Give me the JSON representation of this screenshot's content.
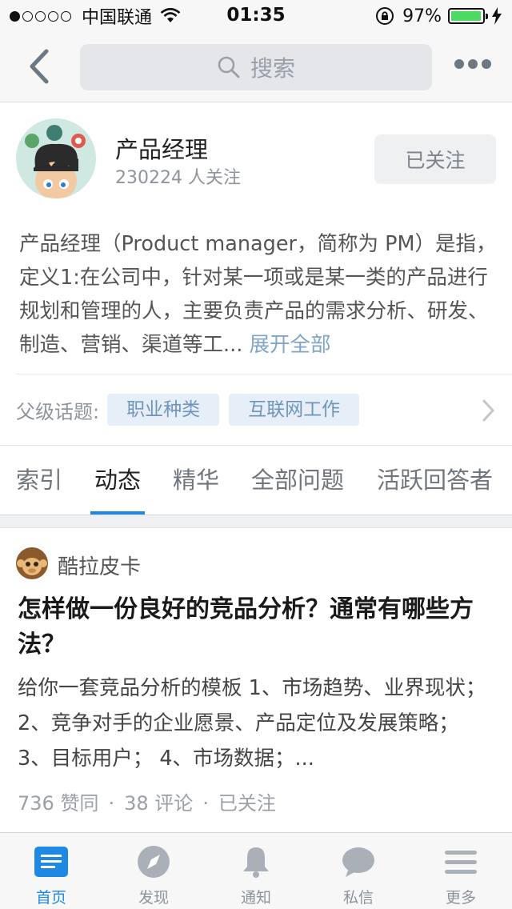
{
  "status_bar": {
    "carrier": "中国联通",
    "time": "01:35",
    "battery": "97%",
    "battery_level": 0.97
  },
  "nav": {
    "search_placeholder": "搜索"
  },
  "topic": {
    "title": "产品经理",
    "followers": "230224 人关注",
    "follow_label": "已关注",
    "description": "产品经理（Product manager，简称为 PM）是指，定义1:在公司中，针对某一项或是某一类的产品进行规划和管理的人，主要负责产品的需求分析、研发、制造、营销、渠道等工...",
    "expand_label": "展开全部",
    "parent_label": "父级话题:",
    "parent_tags": [
      "职业种类",
      "互联网工作"
    ]
  },
  "tabs": [
    "索引",
    "动态",
    "精华",
    "全部问题",
    "活跃回答者"
  ],
  "active_tab": "动态",
  "feed": [
    {
      "author": "酷拉皮卡",
      "title": "怎样做一份良好的竞品分析？通常有哪些方法？",
      "excerpt": "给你一套竞品分析的模板 1、市场趋势、业界现状； 2、竞争对手的企业愿景、产品定位及发展策略； 3、目标用户； 4、市场数据；...",
      "likes": "736 赞同",
      "comments": "38 评论",
      "status": "已关注"
    }
  ],
  "tab_bar": {
    "items": [
      {
        "label": "首页",
        "icon": "home-icon"
      },
      {
        "label": "发现",
        "icon": "compass-icon"
      },
      {
        "label": "通知",
        "icon": "bell-icon"
      },
      {
        "label": "私信",
        "icon": "chat-bubble-icon"
      },
      {
        "label": "更多",
        "icon": "menu-icon"
      }
    ],
    "active": "首页"
  },
  "colors": {
    "accent": "#1e88e5",
    "link": "#7fa6c9",
    "tag_bg": "#e6eef7",
    "battery": "#4cd964"
  }
}
